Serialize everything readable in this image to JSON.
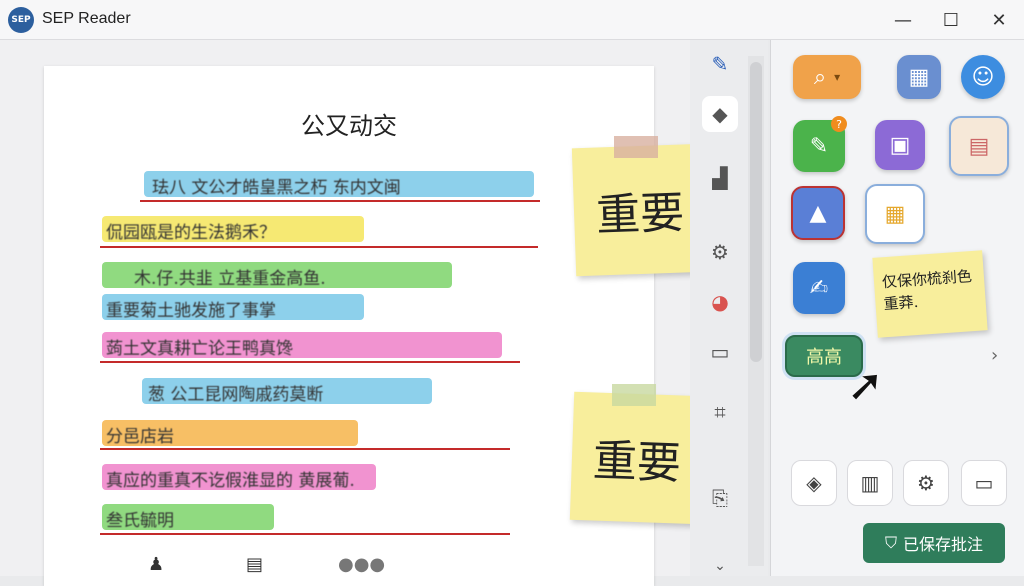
{
  "app": {
    "logo": "SEP",
    "title": "SEP Reader"
  },
  "window": {
    "minimize": "—",
    "maximize": "☐",
    "close": "✕"
  },
  "document": {
    "title": "公又动交",
    "lines": [
      {
        "text": "珐八 文公才皓皇黑之朽  东内文闽",
        "color": "#79c8e8"
      },
      {
        "text": "侃园瓯是的生法鹅禾？",
        "color": "#f5e55a"
      },
      {
        "text": "木.仔.共韭  立基重金高鱼.",
        "color": "#7dd46a"
      },
      {
        "text": "重要菊土驰发施了事掌",
        "color": "#79c8e8"
      },
      {
        "text": "蒟土文真耕亡论王鸭真馋",
        "color": "#ee80c8"
      },
      {
        "text": "葱  公工昆网陶戚药莫断",
        "color": "#79c8e8"
      },
      {
        "text": "分邑店岩",
        "color": "#f6b44a"
      },
      {
        "text": "真应的重真不讫假淮显的  黄展葡.",
        "color": "#ee80c8"
      },
      {
        "text": "叁氏毓明",
        "color": "#7dd46a"
      }
    ],
    "sticky_notes": [
      "重要",
      "重要"
    ],
    "footer_icons": [
      "pin-icon",
      "bookmark-icon",
      "avatars-icon"
    ]
  },
  "toolbar": {
    "items": [
      "pen-icon",
      "comment-icon",
      "chart-icon",
      "settings-icon",
      "palette-icon",
      "chat-icon",
      "crop-icon",
      "export-icon",
      "chevron-down-icon"
    ]
  },
  "panel": {
    "search_dropdown": "▾",
    "note_text": "仅保你梳刹色重莽.",
    "highlight_button": "高高",
    "expand": "›",
    "bottom_tools": [
      "layers-icon",
      "task-icon",
      "gear-icon",
      "card-icon"
    ],
    "saved_label": "已保存批注"
  },
  "colors": {
    "accent": "#2f7d5b",
    "red_underline": "#c42a2a",
    "note_yellow": "#f8ee9c"
  }
}
